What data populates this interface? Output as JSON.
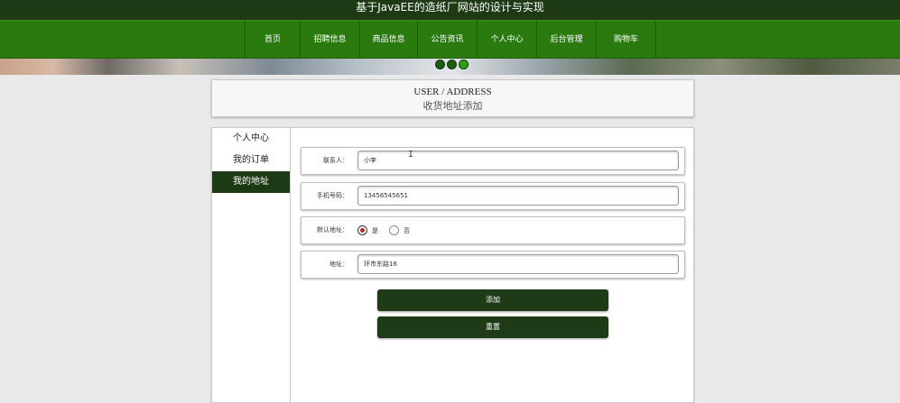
{
  "site": {
    "title": "基于JavaEE的造纸厂网站的设计与实现"
  },
  "nav": {
    "items": [
      {
        "label": "首页"
      },
      {
        "label": "招聘信息"
      },
      {
        "label": "商品信息"
      },
      {
        "label": "公告资讯"
      },
      {
        "label": "个人中心"
      },
      {
        "label": "后台管理"
      },
      {
        "label": "购物车"
      }
    ]
  },
  "banner": {
    "active_dot": 3,
    "dot_count": 3
  },
  "heading": {
    "en": "USER / ADDRESS",
    "cn": "收货地址添加"
  },
  "sidebar": {
    "items": [
      {
        "label": "个人中心",
        "active": false
      },
      {
        "label": "我的订单",
        "active": false
      },
      {
        "label": "我的地址",
        "active": true
      }
    ]
  },
  "form": {
    "contact": {
      "label": "联系人：",
      "value": "小李"
    },
    "phone": {
      "label": "手机号码：",
      "value": "13456545651"
    },
    "default": {
      "label": "默认地址：",
      "options": [
        "是",
        "否"
      ],
      "selected": "是"
    },
    "address": {
      "label": "地址：",
      "value": "环市东路16"
    },
    "submit_label": "添加",
    "reset_label": "重置"
  },
  "colors": {
    "topbar": "#1d3a14",
    "navbar": "#2a7a10",
    "accent": "#1f3a17"
  },
  "icons": {
    "cursor": "text-cursor-icon"
  }
}
